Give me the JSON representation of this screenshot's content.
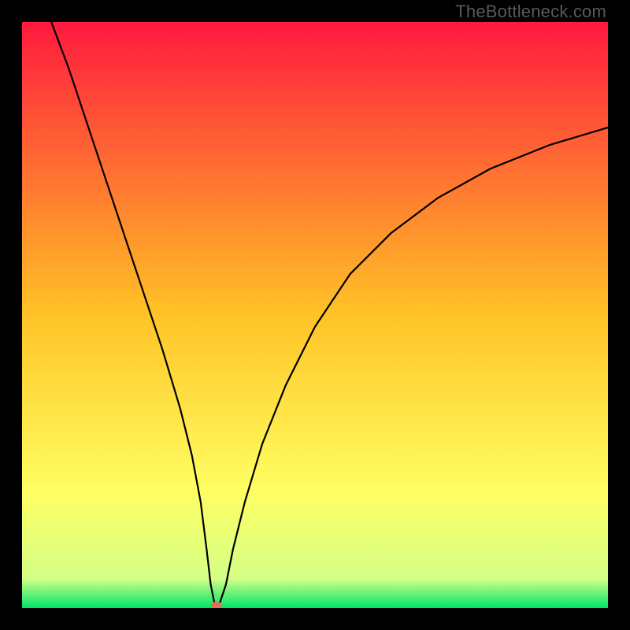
{
  "watermark": {
    "text": "TheBottleneck.com"
  },
  "chart_data": {
    "type": "line",
    "title": "",
    "xlabel": "",
    "ylabel": "",
    "xlim": [
      0,
      100
    ],
    "ylim": [
      0,
      100
    ],
    "background_gradient": {
      "stops": [
        {
          "offset": 0.0,
          "color": "#ff1a3e"
        },
        {
          "offset": 0.5,
          "color": "#ffc326"
        },
        {
          "offset": 0.8,
          "color": "#ffff63"
        },
        {
          "offset": 0.95,
          "color": "#d4ff86"
        },
        {
          "offset": 1.0,
          "color": "#00e56a"
        }
      ]
    },
    "curve": [
      {
        "x": 5,
        "y": 100
      },
      {
        "x": 8,
        "y": 92
      },
      {
        "x": 12,
        "y": 80
      },
      {
        "x": 16,
        "y": 68
      },
      {
        "x": 20,
        "y": 56
      },
      {
        "x": 24,
        "y": 44
      },
      {
        "x": 27,
        "y": 34
      },
      {
        "x": 29,
        "y": 26
      },
      {
        "x": 30.5,
        "y": 18
      },
      {
        "x": 31.5,
        "y": 10
      },
      {
        "x": 32.2,
        "y": 4
      },
      {
        "x": 32.8,
        "y": 1
      },
      {
        "x": 33.2,
        "y": 0
      },
      {
        "x": 33.8,
        "y": 1
      },
      {
        "x": 34.8,
        "y": 4
      },
      {
        "x": 36,
        "y": 10
      },
      {
        "x": 38,
        "y": 18
      },
      {
        "x": 41,
        "y": 28
      },
      {
        "x": 45,
        "y": 38
      },
      {
        "x": 50,
        "y": 48
      },
      {
        "x": 56,
        "y": 57
      },
      {
        "x": 63,
        "y": 64
      },
      {
        "x": 71,
        "y": 70
      },
      {
        "x": 80,
        "y": 75
      },
      {
        "x": 90,
        "y": 79
      },
      {
        "x": 100,
        "y": 82
      }
    ],
    "marker": {
      "x": 33.2,
      "y": 0.4,
      "color": "#e2705a"
    }
  }
}
